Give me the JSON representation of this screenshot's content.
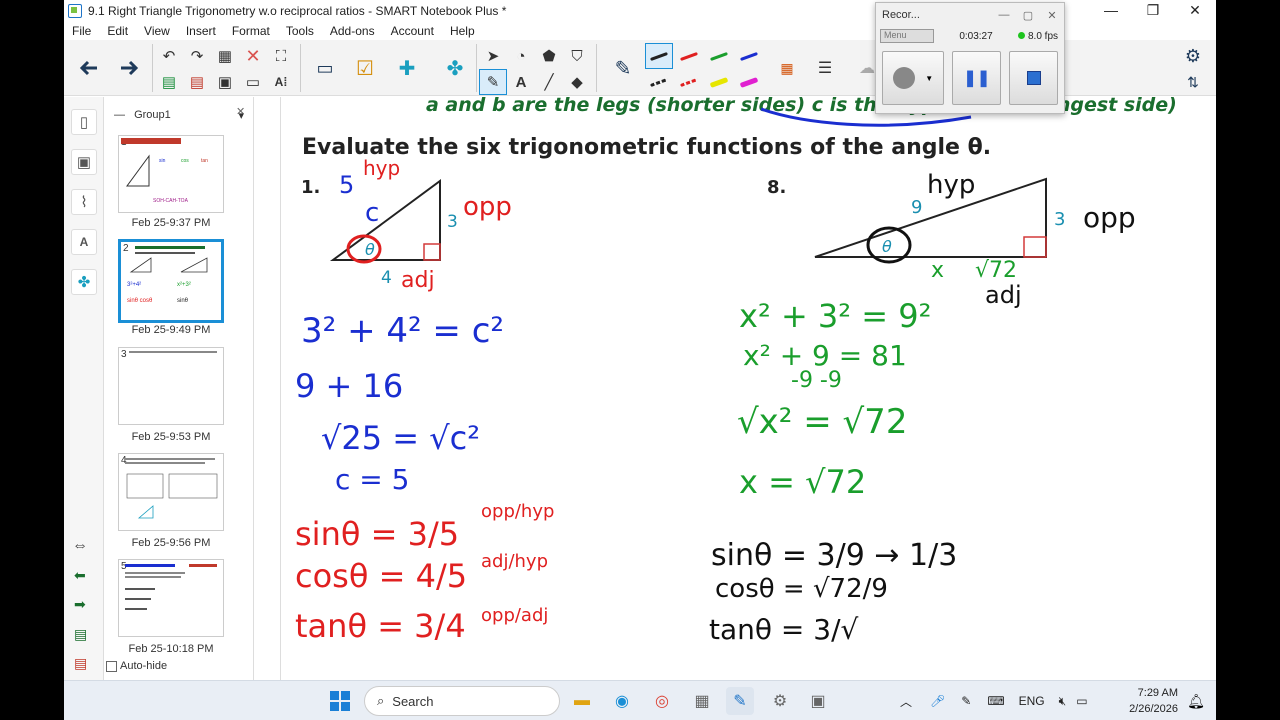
{
  "window": {
    "title": "9.1 Right Triangle Trigonometry w.o reciprocal ratios - SMART Notebook Plus *",
    "controls": [
      "—",
      "❐",
      "✕"
    ]
  },
  "menu": [
    "File",
    "Edit",
    "View",
    "Insert",
    "Format",
    "Tools",
    "Add-ons",
    "Account",
    "Help"
  ],
  "sorter": {
    "group": "Group1",
    "thumbs": [
      {
        "num": "1",
        "label": "Feb 25-9:37 PM",
        "caption": "SOH-CAH-TOA"
      },
      {
        "num": "2",
        "label": "Feb 25-9:49 PM"
      },
      {
        "num": "3",
        "label": "Feb 25-9:53 PM"
      },
      {
        "num": "4",
        "label": "Feb 25-9:56 PM"
      },
      {
        "num": "5",
        "label": "Feb 25-10:18 PM"
      }
    ],
    "autohide": "Auto-hide"
  },
  "page": {
    "top_text": "a and b are the legs (shorter sides) c is the hypotenuse (longest side)",
    "heading": "Evaluate the six trigonometric functions of the angle θ.",
    "p1": {
      "num": "1.",
      "side_right": "3",
      "side_bottom": "4",
      "theta": "θ",
      "hand_hyp": "hyp",
      "hand_5": "5",
      "hand_c": "c",
      "hand_opp": "opp",
      "hand_adj": "adj",
      "work": [
        "3² + 4² = c²",
        "9 + 16",
        "√25 = √c²",
        "c = 5"
      ],
      "sin": "sinθ = 3/5",
      "cos": "cosθ = 4/5",
      "tan": "tanθ = 3/4",
      "sin_note": "opp/hyp",
      "cos_note": "adj/hyp",
      "tan_note": "opp/adj"
    },
    "p8": {
      "num": "8.",
      "side_left": "9",
      "side_right": "3",
      "theta": "θ",
      "hand_hyp": "hyp",
      "hand_opp": "opp",
      "hand_adj": "adj",
      "hand_x": "x",
      "hand_sqrt": "√72",
      "work": [
        "x² + 3² = 9²",
        "x² + 9 = 81",
        "-9 -9",
        "√x² = √72",
        "x = √72"
      ],
      "sin": "sinθ = 3/9 → 1/3",
      "cos": "cosθ = √72/9",
      "tan": "tanθ = 3/√"
    }
  },
  "recorder": {
    "title": "Recor...",
    "menu": "Menu",
    "time": "0:03:27",
    "fps": "8.0 fps"
  },
  "taskbar": {
    "search": "Search",
    "lang": "ENG",
    "time": "7:29 AM",
    "date": "2/26/2026"
  }
}
